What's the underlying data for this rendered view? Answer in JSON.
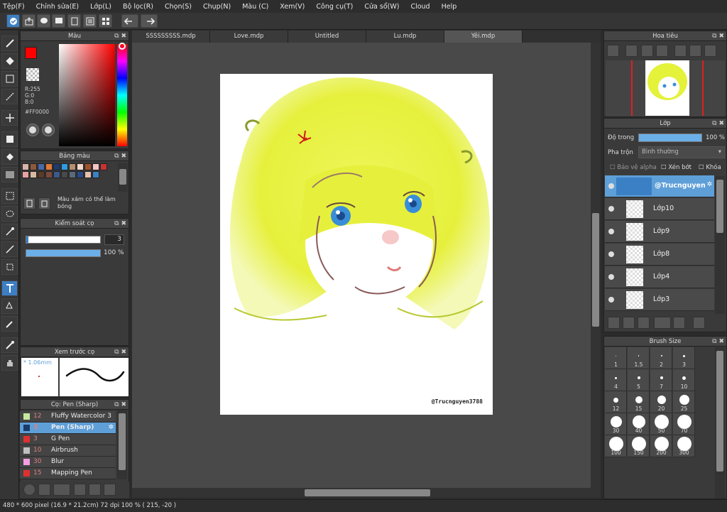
{
  "menu": [
    "Tệp(F)",
    "Chỉnh sửa(E)",
    "Lớp(L)",
    "Bộ lọc(R)",
    "Chọn(S)",
    "Chụp(N)",
    "Màu (C)",
    "Xem(V)",
    "Công cụ(T)",
    "Cửa sổ(W)",
    "Cloud",
    "Help"
  ],
  "color_panel": {
    "title": "Màu",
    "r": "R:255",
    "g": "G:0",
    "b": "B:0",
    "hex": "#FF0000"
  },
  "palette_panel": {
    "title": "Bảng màu",
    "note": "Màu xám có thể làm bóng",
    "swatches": [
      "#d8b5a8",
      "#8b5a3c",
      "#4a6aa8",
      "#e07b3a",
      "#1f3a6e",
      "#2d9be0",
      "#b49070",
      "#f4d7c8",
      "#a0522d",
      "#f2c4c4",
      "#c83232",
      "#e8a0a0",
      "#d9b8a0",
      "#5a3a2a",
      "#7a4a3a",
      "#3a5a8a",
      "#4a4a4a",
      "#5a6a7a",
      "#2a4a8a",
      "#e8c0b0",
      "#3b82c4"
    ]
  },
  "brush_control": {
    "title": "Kiểm soát cọ",
    "size": "3",
    "opacity": "100 %"
  },
  "brush_preview": {
    "title": "Xem trước cọ",
    "size": "* 1.06mm"
  },
  "brush_list": {
    "title": "Cọ: Pen (Sharp)",
    "items": [
      {
        "size": "12",
        "name": "Fluffy Watercolor 3",
        "color": "#c8e8a0"
      },
      {
        "size": "3",
        "name": "Pen (Sharp)",
        "color": "#1a3a6a"
      },
      {
        "size": "3",
        "name": "G Pen",
        "color": "#e03030"
      },
      {
        "size": "10",
        "name": "Airbrush",
        "color": "#c0c0c0"
      },
      {
        "size": "30",
        "name": "Blur",
        "color": "#f0a0e0"
      },
      {
        "size": "15",
        "name": "Mapping Pen",
        "color": "#e03030"
      }
    ]
  },
  "tabs": [
    "SSSSSSSSS.mdp",
    "Love.mdp",
    "Untitled",
    "Lu.mdp",
    "Yêi.mdp"
  ],
  "canvas": {
    "watermark": "@Trucnguyen3788"
  },
  "navigator": {
    "title": "Hoa tiêu"
  },
  "layers": {
    "title": "Lớp",
    "opacity_label": "Độ trong",
    "opacity_value": "100 %",
    "blend_label": "Pha trộn",
    "blend_value": "Bình thường",
    "alpha_protect": "Bảo vệ alpha",
    "clipping": "Xén bớt",
    "lock": "Khóa",
    "items": [
      "@Trucnguyen",
      "Lớp10",
      "Lớp9",
      "Lớp8",
      "Lớp4",
      "Lớp3"
    ]
  },
  "brush_size": {
    "title": "Brush Size",
    "sizes": [
      "1",
      "1.5",
      "2",
      "3",
      "4",
      "5",
      "7",
      "10",
      "12",
      "15",
      "20",
      "25",
      "30",
      "40",
      "50",
      "70",
      "100",
      "150",
      "200",
      "300"
    ]
  },
  "status": {
    "text": "480 * 600 pixel   (16.9 * 21.2cm)   72 dpi   100 %   ( 215, -20 )"
  },
  "colors": {
    "accent": "#5e9fd8",
    "foreground": "#ff0000",
    "hair": "#e4f23a"
  }
}
